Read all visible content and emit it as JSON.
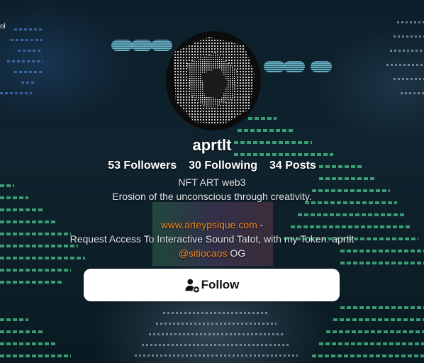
{
  "profile": {
    "username": "aprtlt",
    "avatar_alt": "profile avatar"
  },
  "stats": {
    "followers": "53 Followers",
    "following": "30 Following",
    "posts": "34 Posts"
  },
  "bio": {
    "line1": "NFT ART web3",
    "line2": "Erosion of the unconscious through creativity.",
    "website": "www.arteypsique.com",
    "website_suffix": " -",
    "line4": "Request Access To Interactive Sound Tatot, with my Token: aprtlt",
    "mention": "@sitiocaos",
    "mention_suffix": " OG"
  },
  "corner_text": "ol",
  "follow_button": {
    "label": "Follow",
    "icon": "user-plus-icon"
  },
  "colors": {
    "accent": "#f08a24",
    "button_bg": "#ffffff"
  }
}
